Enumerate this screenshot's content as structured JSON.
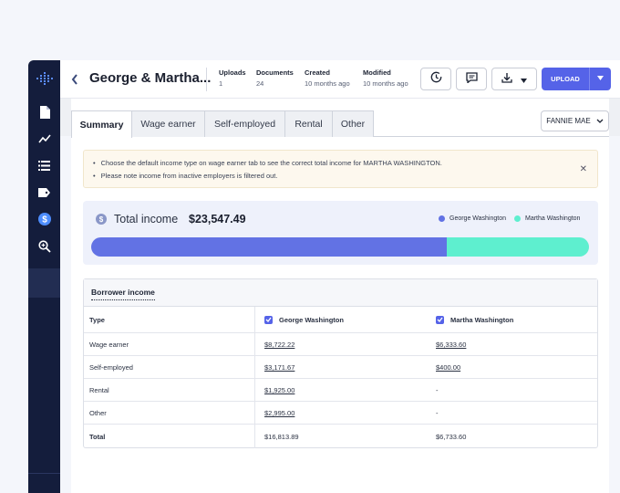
{
  "header": {
    "back_icon": "chevron-left-icon",
    "title": "George & Martha...",
    "meta": [
      {
        "label": "Uploads",
        "value": "1"
      },
      {
        "label": "Documents",
        "value": "24"
      },
      {
        "label": "Created",
        "value": "10 months ago"
      },
      {
        "label": "Modified",
        "value": "10 months ago"
      }
    ],
    "upload_label": "UPLOAD"
  },
  "sidebar": {
    "items": [
      {
        "name": "document-icon"
      },
      {
        "name": "trend-chart-icon"
      },
      {
        "name": "list-icon"
      },
      {
        "name": "tag-icon"
      },
      {
        "name": "dollar-icon",
        "active": true
      },
      {
        "name": "zoom-search-icon"
      }
    ]
  },
  "tabs": [
    {
      "label": "Summary",
      "active": true
    },
    {
      "label": "Wage earner"
    },
    {
      "label": "Self-employed"
    },
    {
      "label": "Rental"
    },
    {
      "label": "Other"
    }
  ],
  "guideline_select": {
    "value": "FANNIE MAE"
  },
  "notice": {
    "lines": [
      "Choose the default income type on wage earner tab to see the correct total income for MARTHA WASHINGTON.",
      "Please note income from inactive employers is filtered out."
    ]
  },
  "total_income": {
    "label": "Total income",
    "value": "$23,547.49",
    "legend": [
      {
        "name": "George Washington",
        "color": "#6272e4"
      },
      {
        "name": "Martha Washington",
        "color": "#5eefcf"
      }
    ],
    "george_share": 0.714
  },
  "borrower_income": {
    "title": "Borrower income",
    "columns": [
      "Type",
      "George Washington",
      "Martha Washington"
    ],
    "rows": [
      {
        "type": "Wage earner",
        "george": "$8,722.22",
        "martha": "$6,333.60"
      },
      {
        "type": "Self-employed",
        "george": "$3,171.67",
        "martha": "$400.00"
      },
      {
        "type": "Rental",
        "george": "$1,925.00",
        "martha": "-"
      },
      {
        "type": "Other",
        "george": "$2,995.00",
        "martha": "-"
      }
    ],
    "total": {
      "type": "Total",
      "george": "$16,813.89",
      "martha": "$6,733.60"
    }
  }
}
